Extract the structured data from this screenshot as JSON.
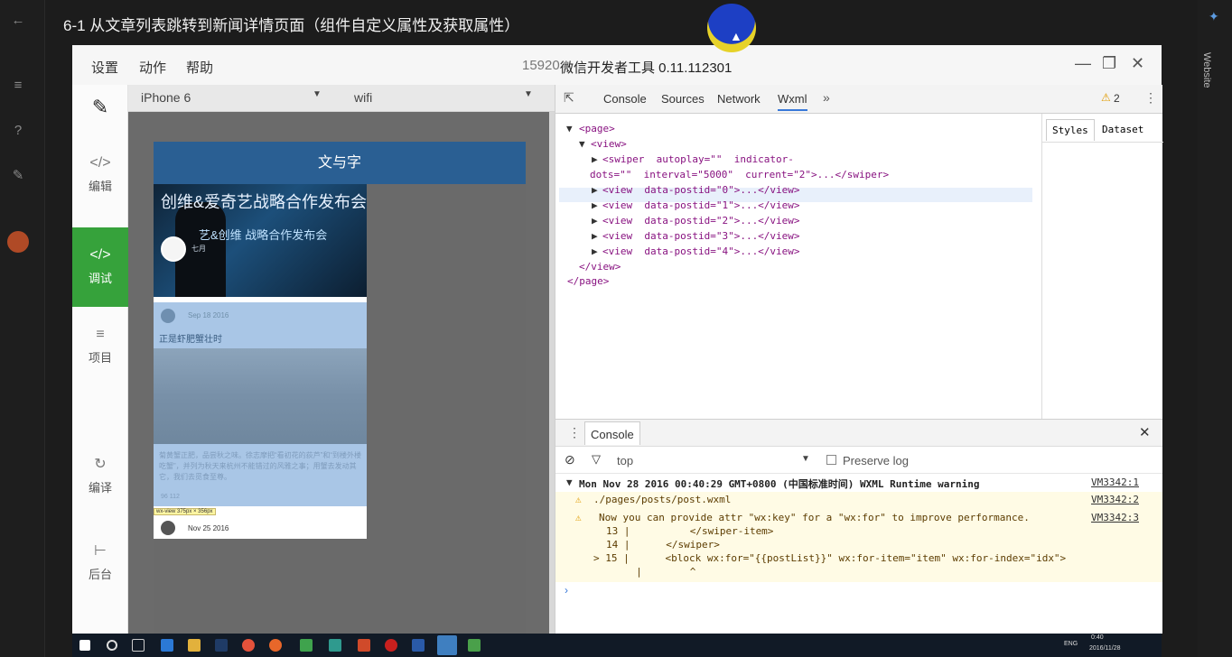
{
  "video": {
    "title": "6-1 从文章列表跳转到新闻详情页面（组件自定义属性及获取属性）",
    "right_rail_label": "Website"
  },
  "ide": {
    "menu": [
      "设置",
      "动作",
      "帮助"
    ],
    "title_prefix": "15920",
    "title": "微信开发者工具 0.11.112301",
    "sidebar": [
      {
        "label": "编辑",
        "icon": "code-file-icon"
      },
      {
        "label": "调试",
        "icon": "code-icon",
        "active": true
      },
      {
        "label": "项目",
        "icon": "menu-icon"
      },
      {
        "label": "编译",
        "icon": "compile-icon"
      },
      {
        "label": "后台",
        "icon": "backend-icon"
      }
    ]
  },
  "simulator": {
    "device": "iPhone 6",
    "network": "wifi",
    "nav_title": "文与字",
    "swiper": {
      "title": "创维&爱奇艺战略合作发布会",
      "subtitle": "艺&创维 战略合作发布会",
      "date": "七月"
    },
    "post": {
      "date": "Sep 18 2016",
      "title": "正是虾肥蟹壮时",
      "content": "菊黄蟹正肥，品尝秋之味。徐志摩把“看初花的荻芦”和“到楼外楼吃蟹”，并列为秋天来杭州不能错过的风雅之事；用蟹去发动其它，我们去觅食至尊。",
      "stats": "96        112",
      "tooltip": "wx-view 375px × 356px"
    },
    "post2": {
      "date": "Nov 25 2016"
    }
  },
  "devtools": {
    "tabs": [
      "Console",
      "Sources",
      "Network",
      "Wxml"
    ],
    "active_tab": "Wxml",
    "warning_count": "2",
    "styles_tabs": [
      "Styles",
      "Dataset"
    ],
    "tree": {
      "page_open": "<page>",
      "view_open": "<view>",
      "swiper_line1": "<swiper  autoplay=\"\"  indicator-",
      "swiper_line2": "dots=\"\"  interval=\"5000\"  current=\"2\">...</swiper>",
      "rows": [
        "<view  data-postid=\"0\">...</view>",
        "<view  data-postid=\"1\">...</view>",
        "<view  data-postid=\"2\">...</view>",
        "<view  data-postid=\"3\">...</view>",
        "<view  data-postid=\"4\">...</view>"
      ],
      "view_close": "</view>",
      "page_close": "</page>"
    },
    "console": {
      "drawer_title": "Console",
      "context": "top",
      "preserve_log": "Preserve log",
      "warning_header": "Mon Nov 28 2016 00:40:29 GMT+0800 (中国标准时间) WXML Runtime warning",
      "source1": "VM3342:1",
      "file_path": "./pages/posts/post.wxml",
      "source2": "VM3342:2",
      "message": "Now you can provide attr \"wx:key\" for a \"wx:for\" to improve performance.",
      "source3": "VM3342:3",
      "code": [
        "13 |          </swiper-item>",
        "14 |      </swiper>",
        "> 15 |      <block wx:for=\"{{postList}}\" wx:for-item=\"item\" wx:for-index=\"idx\">",
        "     |        ^"
      ]
    }
  },
  "taskbar": {
    "lang": "ENG",
    "time": "0:40",
    "date": "2016/11/28"
  }
}
